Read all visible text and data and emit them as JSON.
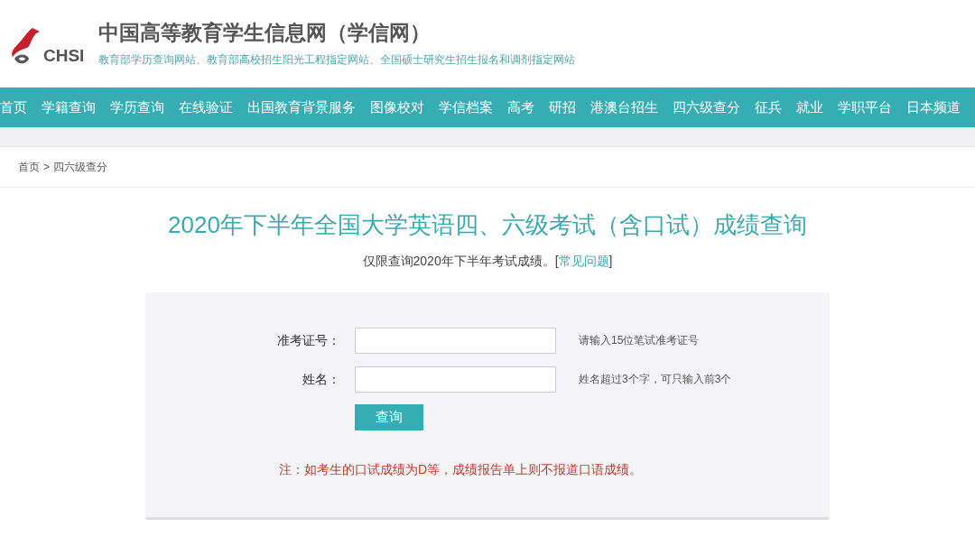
{
  "header": {
    "logo_text": "CHSI",
    "title": "中国高等教育学生信息网（学信网）",
    "subtitle": "教育部学历查询网站、教育部高校招生阳光工程指定网站、全国硕士研究生招生报名和调剂指定网站"
  },
  "nav": [
    "首页",
    "学籍查询",
    "学历查询",
    "在线验证",
    "出国教育背景服务",
    "图像校对",
    "学信档案",
    "高考",
    "研招",
    "港澳台招生",
    "四六级查分",
    "征兵",
    "就业",
    "学职平台",
    "日本频道"
  ],
  "breadcrumb": {
    "items": [
      "首页",
      "四六级查分"
    ],
    "separator": ">"
  },
  "heading": "2020年下半年全国大学英语四、六级考试（含口试）成绩查询",
  "notice": {
    "text": "仅限查询2020年下半年考试成绩。[",
    "link": "常见问题",
    "close": "]"
  },
  "form": {
    "fields": [
      {
        "label": "准考证号：",
        "hint": "请输入15位笔试准考证号"
      },
      {
        "label": "姓名：",
        "hint": "姓名超过3个字，可只输入前3个"
      }
    ],
    "button": "查询",
    "note": "注：如考生的口试成绩为D等，成绩报告单上则不报道口语成绩。"
  }
}
